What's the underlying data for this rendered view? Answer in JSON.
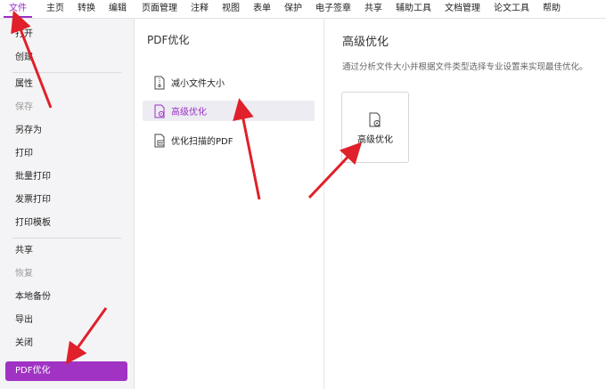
{
  "menubar": {
    "items": [
      "文件",
      "主页",
      "转换",
      "编辑",
      "页面管理",
      "注释",
      "视图",
      "表单",
      "保护",
      "电子签章",
      "共享",
      "辅助工具",
      "文档管理",
      "论文工具",
      "帮助"
    ]
  },
  "sidebar": {
    "items": [
      "打开",
      "创建",
      "属性",
      "保存",
      "另存为",
      "打印",
      "批量打印",
      "发票打印",
      "打印模板",
      "共享",
      "恢复",
      "本地备份",
      "导出",
      "关闭",
      "PDF优化"
    ],
    "disabled": [
      "保存",
      "恢复"
    ],
    "selected": "PDF优化"
  },
  "middle": {
    "title": "PDF优化",
    "options": [
      "减小文件大小",
      "高级优化",
      "优化扫描的PDF"
    ],
    "selected": "高级优化"
  },
  "right": {
    "title": "高级优化",
    "description": "通过分析文件大小并根据文件类型选择专业设置来实现最佳优化。",
    "card_label": "高级优化"
  },
  "colors": {
    "accent": "#9b2fc4",
    "selected_bg": "#a033c4",
    "annotation_arrow": "#e0202a"
  },
  "icons": {
    "reduce": "file-zip-icon",
    "advanced": "file-gear-icon",
    "scan": "file-scan-icon"
  }
}
